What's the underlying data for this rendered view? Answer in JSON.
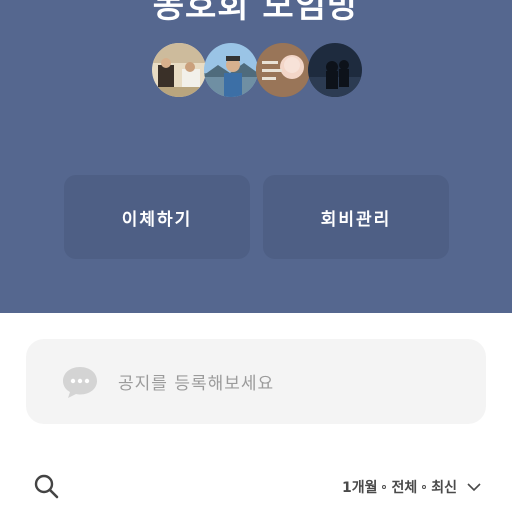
{
  "header": {
    "group_title": "동호회 모임방",
    "members": [
      {
        "icon": "member-avatar-1"
      },
      {
        "icon": "member-avatar-2"
      },
      {
        "icon": "member-avatar-3"
      },
      {
        "icon": "member-avatar-4"
      }
    ],
    "actions": {
      "transfer_label": "이체하기",
      "dues_label": "회비관리"
    }
  },
  "notice": {
    "placeholder": "공지를 등록해보세요",
    "icon": "speech-bubble-icon"
  },
  "filter_bar": {
    "search_icon": "search-icon",
    "period": "1개월",
    "type": "전체",
    "sort": "최신",
    "dropdown_icon": "chevron-down-icon"
  },
  "colors": {
    "header_bg": "#55678f",
    "button_bg": "#4e5f85",
    "notice_bg": "#f4f4f4"
  }
}
